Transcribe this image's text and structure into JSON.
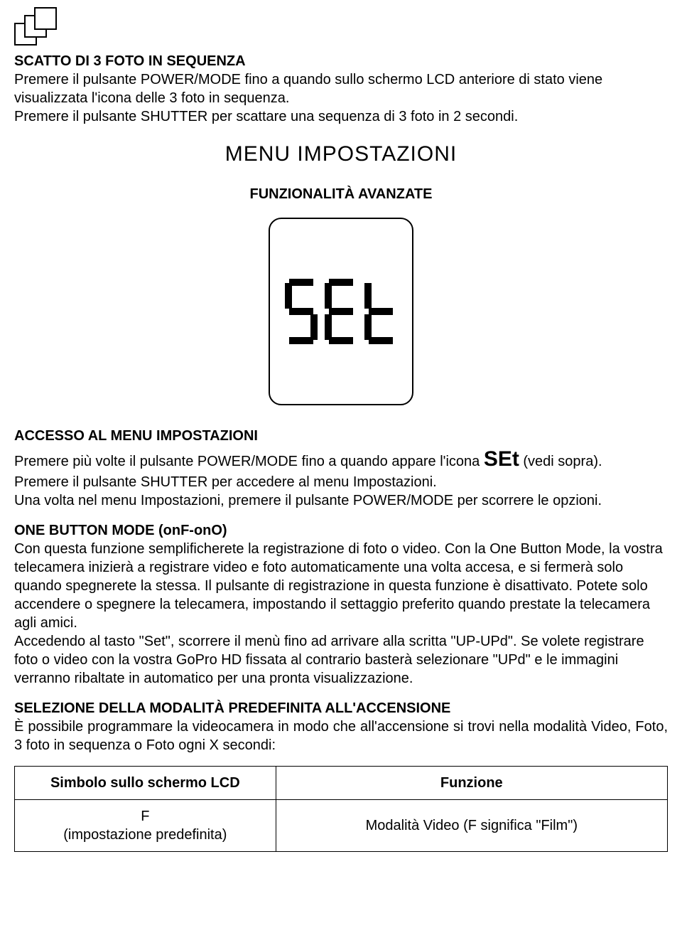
{
  "section1": {
    "heading": "SCATTO DI 3 FOTO IN SEQUENZA",
    "p1": "Premere il pulsante POWER/MODE fino a quando sullo schermo LCD anteriore di stato viene visualizzata l'icona delle 3 foto in sequenza.",
    "p2": "Premere il pulsante SHUTTER per scattare una sequenza di 3 foto in 2 secondi."
  },
  "menu": {
    "title": "MENU IMPOSTAZIONI",
    "subtitle": "FUNZIONALITÀ AVANZATE",
    "lcd": "SEt"
  },
  "access": {
    "heading": "ACCESSO AL MENU IMPOSTAZIONI",
    "line1a": "Premere più volte il pulsante POWER/MODE fino a quando appare l'icona ",
    "line1b": "SEt",
    "line1c": " (vedi sopra).",
    "line2": "Premere il pulsante SHUTTER per accedere al menu Impostazioni.",
    "line3": "Una volta nel menu Impostazioni, premere il pulsante POWER/MODE per scorrere le opzioni."
  },
  "onebutton": {
    "heading": "ONE BUTTON MODE (onF-onO)",
    "p1": "Con questa funzione semplificherete la registrazione di foto o video. Con la One Button Mode, la vostra telecamera inizierà a registrare video e foto automaticamente una volta accesa, e si fermerà solo quando spegnerete la stessa. Il pulsante di registrazione in questa funzione è disattivato. Potete solo accendere o spegnere la telecamera, impostando il settaggio preferito quando prestate la telecamera agli amici.",
    "p2": "Accedendo al tasto \"Set\", scorrere il menù fino ad arrivare alla scritta \"UP-UPd\". Se volete registrare foto o video con la vostra GoPro HD fissata al contrario basterà selezionare \"UPd\" e le immagini verranno ribaltate in automatico per una pronta visualizzazione."
  },
  "defaultmode": {
    "heading": "SELEZIONE DELLA MODALITÀ PREDEFINITA ALL'ACCENSIONE",
    "p1": "È possibile programmare la videocamera in modo che all'accensione si trovi nella modalità Video, Foto, 3 foto in sequenza o Foto ogni X secondi:"
  },
  "table": {
    "header1": "Simbolo sullo schermo LCD",
    "header2": "Funzione",
    "row1col1a": "F",
    "row1col1b": "(impostazione predefinita)",
    "row1col2": "Modalità Video (F significa \"Film\")"
  }
}
